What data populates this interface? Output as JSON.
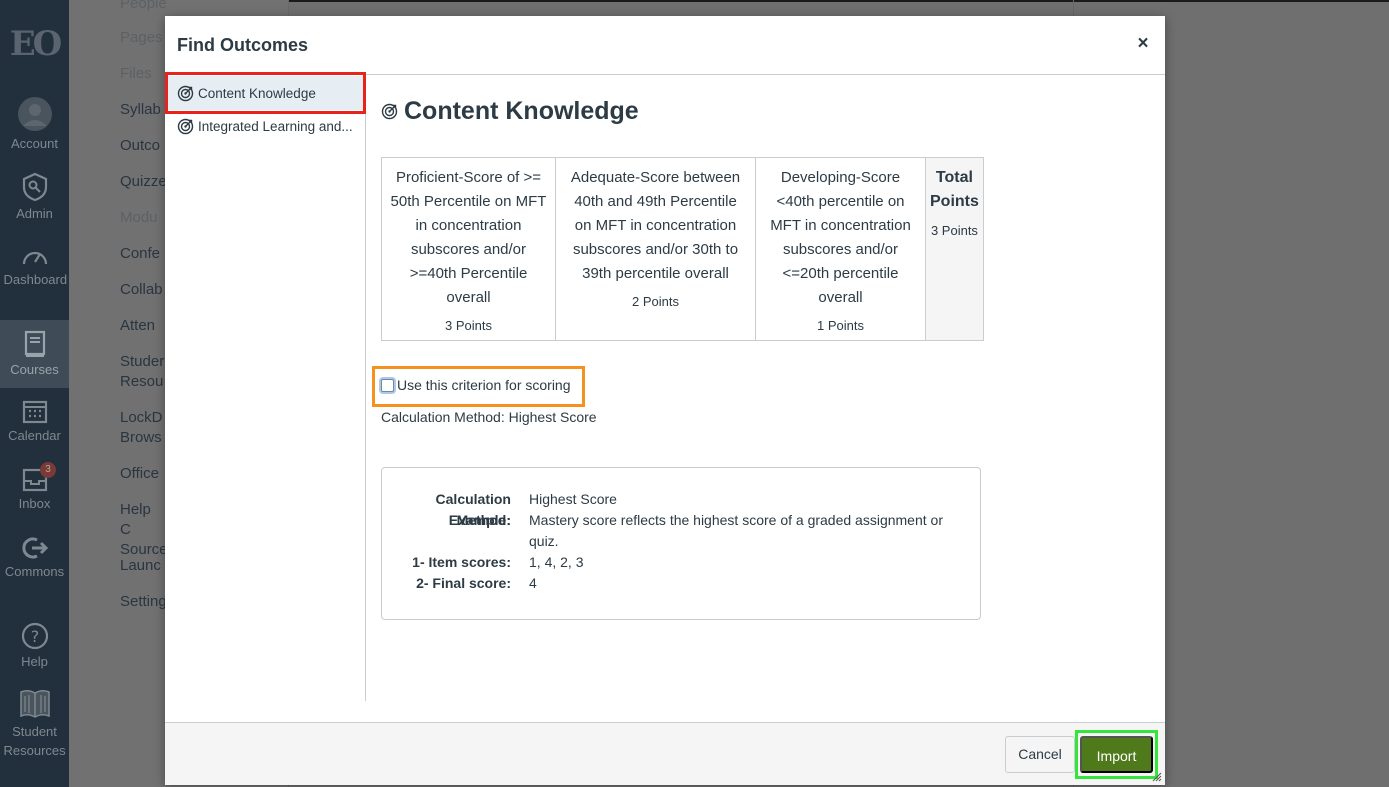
{
  "background": {
    "global_nav": [
      {
        "label": "Account",
        "icon": "account-avatar-icon"
      },
      {
        "label": "Admin",
        "icon": "shield-icon"
      },
      {
        "label": "Dashboard",
        "icon": "speedometer-icon"
      },
      {
        "label": "Courses",
        "icon": "book-icon"
      },
      {
        "label": "Calendar",
        "icon": "calendar-icon"
      },
      {
        "label": "Inbox",
        "icon": "inbox-icon",
        "badge": "3"
      },
      {
        "label": "Commons",
        "icon": "commons-icon"
      },
      {
        "label": "Help",
        "icon": "help-icon"
      },
      {
        "label": "Student Resources",
        "icon": "open-book-icon"
      }
    ],
    "logo_text": "EO",
    "course_menu": [
      "People",
      "Pages",
      "Files",
      "Syllab",
      "Outco",
      "Quizze",
      "Modu",
      "Confe",
      "Collab",
      "Atten",
      "Studer Resou",
      "LockD Brows",
      "Office",
      "Help C Source",
      "Launc",
      "Setting"
    ]
  },
  "modal": {
    "title": "Find Outcomes",
    "close_label": "×",
    "sidebar": [
      {
        "label": "Content Knowledge",
        "selected": true
      },
      {
        "label": "Integrated Learning and...",
        "selected": false
      }
    ],
    "outcome": {
      "title": "Content Knowledge",
      "ratings": [
        {
          "description": "Proficient-Score of >= 50th Percentile on MFT in concentration subscores and/or >=40th Percentile overall",
          "points": "3 Points"
        },
        {
          "description": "Adequate-Score between 40th and 49th Percentile on MFT in concentration subscores and/or 30th to 39th percentile overall",
          "points": "2 Points"
        },
        {
          "description": "Developing-Score <40th percentile on MFT in concentration subscores and/or <=20th percentile overall",
          "points": "1 Points"
        }
      ],
      "total_header": "Total Points",
      "total_points": "3 Points",
      "criterion_label": "Use this criterion for scoring",
      "criterion_checked": false,
      "calc_method_line": "Calculation Method: Highest Score",
      "calc_details": [
        {
          "key": "Calculation Method:",
          "value": "Highest Score"
        },
        {
          "key": "Example:",
          "value": "Mastery score reflects the highest score of a graded assignment or quiz."
        },
        {
          "key": "1- Item scores:",
          "value": "1, 4, 2, 3"
        },
        {
          "key": "2- Final score:",
          "value": "4"
        }
      ]
    },
    "footer": {
      "cancel_label": "Cancel",
      "import_label": "Import"
    },
    "highlight_colors": {
      "red": "#e8231d",
      "orange": "#f5921f",
      "green": "#36e53a"
    },
    "import_color": "#4e7a1b"
  }
}
